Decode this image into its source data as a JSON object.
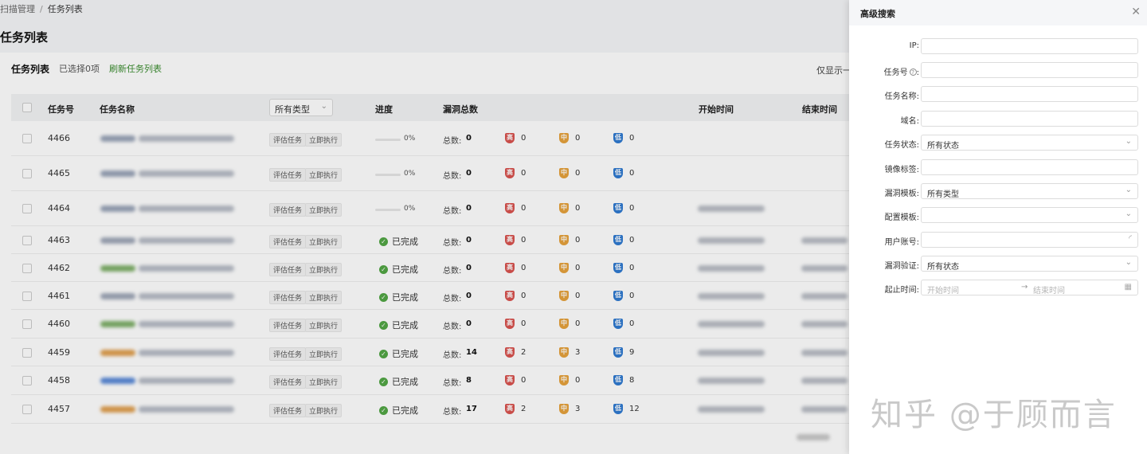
{
  "breadcrumb": {
    "parent": "扫描管理",
    "separator": "/",
    "current": "任务列表"
  },
  "page_title": "任务列表",
  "toolbar": {
    "title": "任务列表",
    "selected": "已选择0项",
    "refresh": "刷新任务列表",
    "right_text": "仅显示一"
  },
  "table": {
    "headers": {
      "id": "任务号",
      "name": "任务名称",
      "type_filter": "所有类型",
      "progress": "进度",
      "vuln_total": "漏洞总数",
      "start": "开始时间",
      "end": "结束时间"
    },
    "total_label": "总数:",
    "severity_labels": {
      "high": "高",
      "mid": "中",
      "low": "低"
    },
    "tags": {
      "type": "评估任务",
      "mode": "立即执行"
    },
    "done_label": "已完成",
    "rows": [
      {
        "id": "4466",
        "status": "progress",
        "progress": "0%",
        "total": "0",
        "high": "0",
        "mid": "0",
        "low": "0"
      },
      {
        "id": "4465",
        "status": "progress",
        "progress": "0%",
        "total": "0",
        "high": "0",
        "mid": "0",
        "low": "0"
      },
      {
        "id": "4464",
        "status": "progress",
        "progress": "0%",
        "total": "0",
        "high": "0",
        "mid": "0",
        "low": "0"
      },
      {
        "id": "4463",
        "status": "done",
        "progress": "",
        "total": "0",
        "high": "0",
        "mid": "0",
        "low": "0"
      },
      {
        "id": "4462",
        "status": "done",
        "progress": "",
        "total": "0",
        "high": "0",
        "mid": "0",
        "low": "0"
      },
      {
        "id": "4461",
        "status": "done",
        "progress": "",
        "total": "0",
        "high": "0",
        "mid": "0",
        "low": "0"
      },
      {
        "id": "4460",
        "status": "done",
        "progress": "",
        "total": "0",
        "high": "0",
        "mid": "0",
        "low": "0"
      },
      {
        "id": "4459",
        "status": "done",
        "progress": "",
        "total": "14",
        "high": "2",
        "mid": "3",
        "low": "9"
      },
      {
        "id": "4458",
        "status": "done",
        "progress": "",
        "total": "8",
        "high": "0",
        "mid": "0",
        "low": "8"
      },
      {
        "id": "4457",
        "status": "done",
        "progress": "",
        "total": "17",
        "high": "2",
        "mid": "3",
        "low": "12"
      }
    ]
  },
  "drawer": {
    "title": "高级搜索",
    "fields": {
      "ip": {
        "label": "IP:",
        "value": ""
      },
      "task_no": {
        "label": "任务号",
        "suffix": ":",
        "value": ""
      },
      "task_name": {
        "label": "任务名称:",
        "value": ""
      },
      "domain": {
        "label": "域名:",
        "value": ""
      },
      "task_status": {
        "label": "任务状态:",
        "value": "所有状态"
      },
      "image_tag": {
        "label": "镜像标签:",
        "value": ""
      },
      "vuln_template": {
        "label": "漏洞模板:",
        "value": "所有类型"
      },
      "config_template": {
        "label": "配置模板:",
        "value": ""
      },
      "user_account": {
        "label": "用户账号:",
        "value": ""
      },
      "vuln_verify": {
        "label": "漏洞验证:",
        "value": "所有状态"
      },
      "time_range": {
        "label": "起止时间:",
        "start_placeholder": "开始时间",
        "end_placeholder": "结束时间"
      }
    }
  },
  "watermark": "知乎 @于顾而言",
  "colors": {
    "accent_green": "#3a8c2f",
    "high": "#d9534f",
    "mid": "#e6a23c",
    "low": "#2f7ad1"
  },
  "icons": {
    "close": "close-icon",
    "help": "question-circle-icon",
    "chevron": "chevron-down-icon",
    "calendar": "calendar-icon",
    "done": "check-circle-icon",
    "shield": "shield-icon"
  }
}
